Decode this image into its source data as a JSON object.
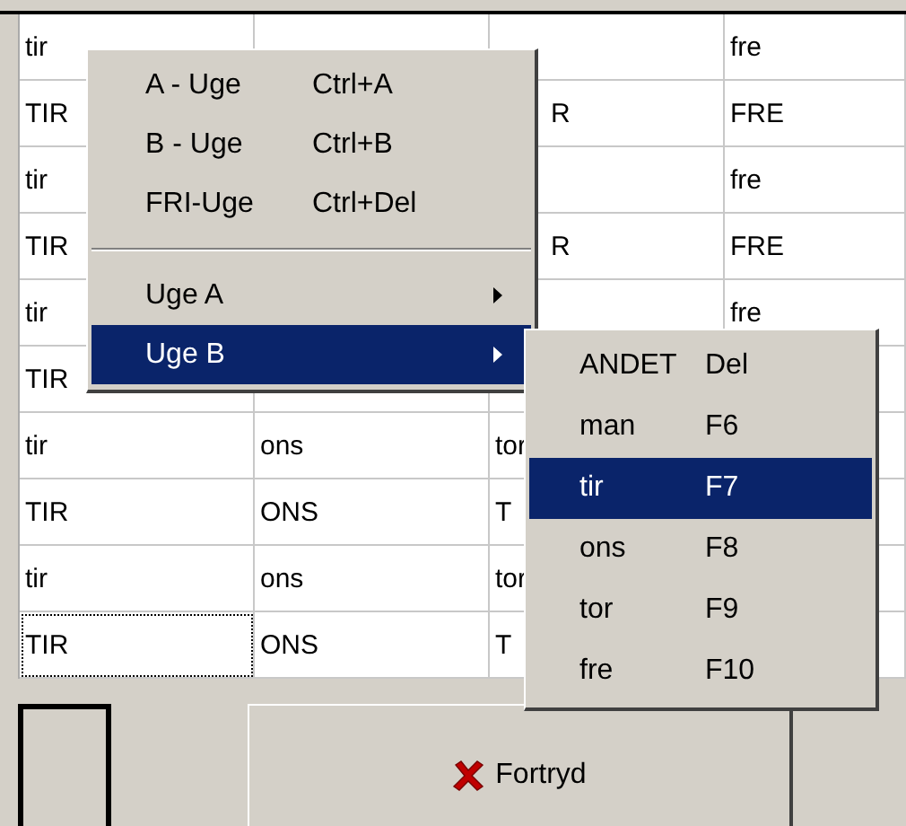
{
  "grid": {
    "rows": [
      {
        "cells": [
          {
            "kind": "text",
            "text": "tir",
            "focused": false
          },
          null,
          null,
          {
            "kind": "text",
            "text": "fre",
            "focused": false
          }
        ]
      },
      {
        "cells": [
          {
            "kind": "text",
            "text": "TIR",
            "focused": false
          },
          null,
          {
            "kind": "fragment",
            "text": "R",
            "focused": false
          },
          {
            "kind": "text",
            "text": "FRE",
            "focused": false
          }
        ]
      },
      {
        "cells": [
          {
            "kind": "text",
            "text": "tir",
            "focused": false
          },
          null,
          null,
          {
            "kind": "text",
            "text": "fre",
            "focused": false
          }
        ]
      },
      {
        "cells": [
          {
            "kind": "text",
            "text": "TIR",
            "focused": false
          },
          null,
          {
            "kind": "fragment",
            "text": "R",
            "focused": false
          },
          {
            "kind": "text",
            "text": "FRE",
            "focused": false
          }
        ]
      },
      {
        "cells": [
          {
            "kind": "text",
            "text": "tir",
            "focused": false
          },
          null,
          null,
          {
            "kind": "text",
            "text": "fre",
            "focused": false
          }
        ]
      },
      {
        "cells": [
          {
            "kind": "text",
            "text": "TIR",
            "focused": false
          },
          null,
          null,
          null
        ]
      },
      {
        "cells": [
          {
            "kind": "text",
            "text": "tir",
            "focused": false
          },
          {
            "kind": "text",
            "text": "ons",
            "focused": false
          },
          {
            "kind": "text",
            "text": "tor",
            "focused": false
          },
          null
        ]
      },
      {
        "cells": [
          {
            "kind": "text",
            "text": "TIR",
            "focused": false
          },
          {
            "kind": "text",
            "text": "ONS",
            "focused": false
          },
          {
            "kind": "text",
            "text": "T",
            "focused": false
          },
          null
        ]
      },
      {
        "cells": [
          {
            "kind": "text",
            "text": "tir",
            "focused": false
          },
          {
            "kind": "text",
            "text": "ons",
            "focused": false
          },
          {
            "kind": "text",
            "text": "tor",
            "focused": false
          },
          null
        ]
      },
      {
        "cells": [
          {
            "kind": "text",
            "text": "TIR",
            "focused": true
          },
          {
            "kind": "text",
            "text": "ONS",
            "focused": false
          },
          {
            "kind": "text",
            "text": "T",
            "focused": false
          },
          null
        ]
      }
    ]
  },
  "context_menu": {
    "items": [
      {
        "kind": "item",
        "label": "A - Uge",
        "shortcut": "Ctrl+A",
        "selected": false
      },
      {
        "kind": "item",
        "label": "B - Uge",
        "shortcut": "Ctrl+B",
        "selected": false
      },
      {
        "kind": "item",
        "label": "FRI-Uge",
        "shortcut": "Ctrl+Del",
        "selected": false
      },
      {
        "kind": "separator"
      },
      {
        "kind": "submenu",
        "label": "Uge A",
        "selected": false
      },
      {
        "kind": "submenu",
        "label": "Uge B",
        "selected": true
      }
    ]
  },
  "submenu": {
    "items": [
      {
        "label": "ANDET",
        "shortcut": "Del",
        "selected": false
      },
      {
        "label": "man",
        "shortcut": "F6",
        "selected": false
      },
      {
        "label": "tir",
        "shortcut": "F7",
        "selected": true
      },
      {
        "label": "ons",
        "shortcut": "F8",
        "selected": false
      },
      {
        "label": "tor",
        "shortcut": "F9",
        "selected": false
      },
      {
        "label": "fre",
        "shortcut": "F10",
        "selected": false
      }
    ]
  },
  "buttons": [
    {
      "kind": "blank",
      "default": true
    },
    {
      "kind": "cancel",
      "label": "Fortryd",
      "default": false
    }
  ]
}
